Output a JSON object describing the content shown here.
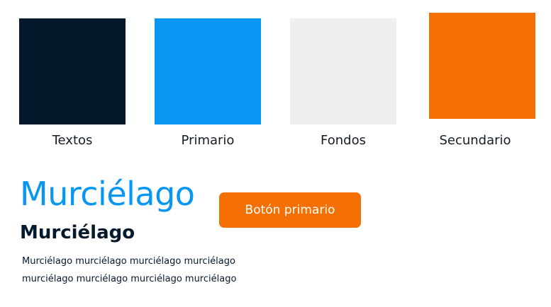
{
  "colors": {
    "textos": "#04192c",
    "primario": "#0797f3",
    "fondos": "#eeeff1",
    "secundario": "#f57003"
  },
  "swatches": [
    {
      "label": "Textos"
    },
    {
      "label": "Primario"
    },
    {
      "label": "Fondos"
    },
    {
      "label": "Secundario"
    }
  ],
  "typography": {
    "heading_large": "Murciélago",
    "heading_medium": "Murciélago",
    "body_lines": [
      "Murciélago murciélago murciélago murciélago",
      "murciélago murciélago murciélago murciélago"
    ]
  },
  "button": {
    "label": "Botón primario"
  }
}
